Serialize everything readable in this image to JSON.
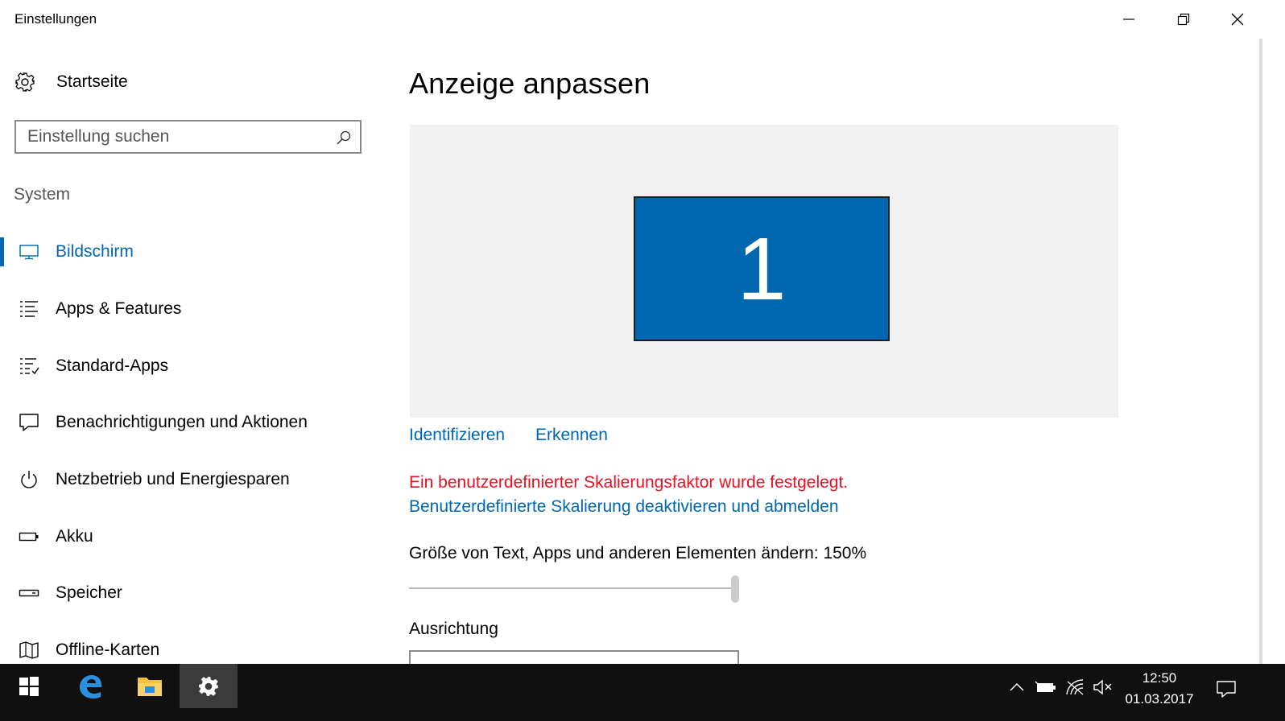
{
  "window": {
    "title": "Einstellungen",
    "minimize_icon": "minimize-icon",
    "restore_icon": "restore-icon",
    "close_icon": "close-icon"
  },
  "sidebar": {
    "home_label": "Startseite",
    "home_icon": "gear-icon",
    "search_placeholder": "Einstellung suchen",
    "search_icon": "search-icon",
    "section_title": "System",
    "items": [
      {
        "label": "Bildschirm",
        "icon": "monitor-icon",
        "active": true
      },
      {
        "label": "Apps & Features",
        "icon": "list-icon",
        "active": false
      },
      {
        "label": "Standard-Apps",
        "icon": "default-apps-icon",
        "active": false
      },
      {
        "label": "Benachrichtigungen und Aktionen",
        "icon": "notification-icon",
        "active": false
      },
      {
        "label": "Netzbetrieb und Energiesparen",
        "icon": "power-icon",
        "active": false
      },
      {
        "label": "Akku",
        "icon": "battery-icon",
        "active": false
      },
      {
        "label": "Speicher",
        "icon": "storage-icon",
        "active": false
      },
      {
        "label": "Offline-Karten",
        "icon": "map-icon",
        "active": false
      }
    ]
  },
  "main": {
    "title": "Anzeige anpassen",
    "monitor_number": "1",
    "identify_link": "Identifizieren",
    "detect_link": "Erkennen",
    "warning": "Ein benutzerdefinierter Skalierungsfaktor wurde festgelegt.",
    "disable_link": "Benutzerdefinierte Skalierung deaktivieren und abmelden",
    "scale_label": "Größe von Text, Apps und anderen Elementen ändern: 150%",
    "scale_slider_fraction": 1.0,
    "orientation_label": "Ausrichtung"
  },
  "colors": {
    "accent": "#0067b0",
    "warning": "#e81123",
    "taskbar": "#101010"
  },
  "taskbar": {
    "pinned": [
      {
        "name": "start-button",
        "icon": "windows-logo-icon"
      },
      {
        "name": "edge-button",
        "icon": "edge-icon"
      },
      {
        "name": "explorer-button",
        "icon": "folder-icon"
      },
      {
        "name": "settings-button",
        "icon": "gear-icon",
        "active": true
      }
    ],
    "tray_icons": [
      "chevron-up-icon",
      "battery-icon",
      "wifi-icon",
      "volume-muted-icon",
      "action-center-icon"
    ],
    "time": "12:50",
    "date": "01.03.2017"
  }
}
